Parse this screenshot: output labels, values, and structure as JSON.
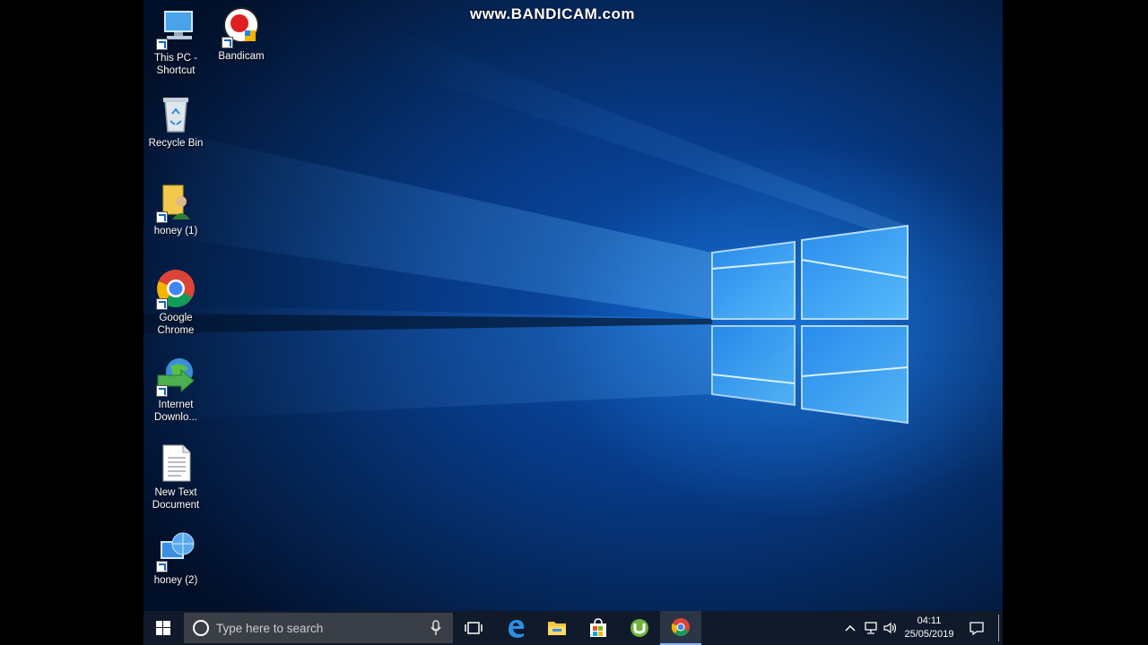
{
  "watermark": "www.BANDICAM.com",
  "desktop_icons": [
    {
      "label": "This PC - Shortcut",
      "icon": "this-pc-icon"
    },
    {
      "label": "Bandicam",
      "icon": "bandicam-icon"
    },
    {
      "label": "Recycle Bin",
      "icon": "recycle-bin-icon"
    },
    {
      "label": "honey  (1)",
      "icon": "user-folder-icon"
    },
    {
      "label": "Google Chrome",
      "icon": "chrome-icon"
    },
    {
      "label": "Internet Downlo...",
      "icon": "internet-download-manager-icon"
    },
    {
      "label": "New Text Document",
      "icon": "text-document-icon"
    },
    {
      "label": "honey  (2)",
      "icon": "network-icon"
    }
  ],
  "taskbar": {
    "search_placeholder": "Type here to search",
    "pinned": [
      "task-view-icon",
      "edge-icon",
      "file-explorer-icon",
      "store-icon",
      "utorrent-icon",
      "chrome-icon"
    ],
    "clock_time": "04:11",
    "clock_date": "25/05/2019"
  },
  "colors": {
    "accent": "#0a4fae",
    "taskbar": "#101a2a",
    "search_box": "#3a3f47"
  }
}
